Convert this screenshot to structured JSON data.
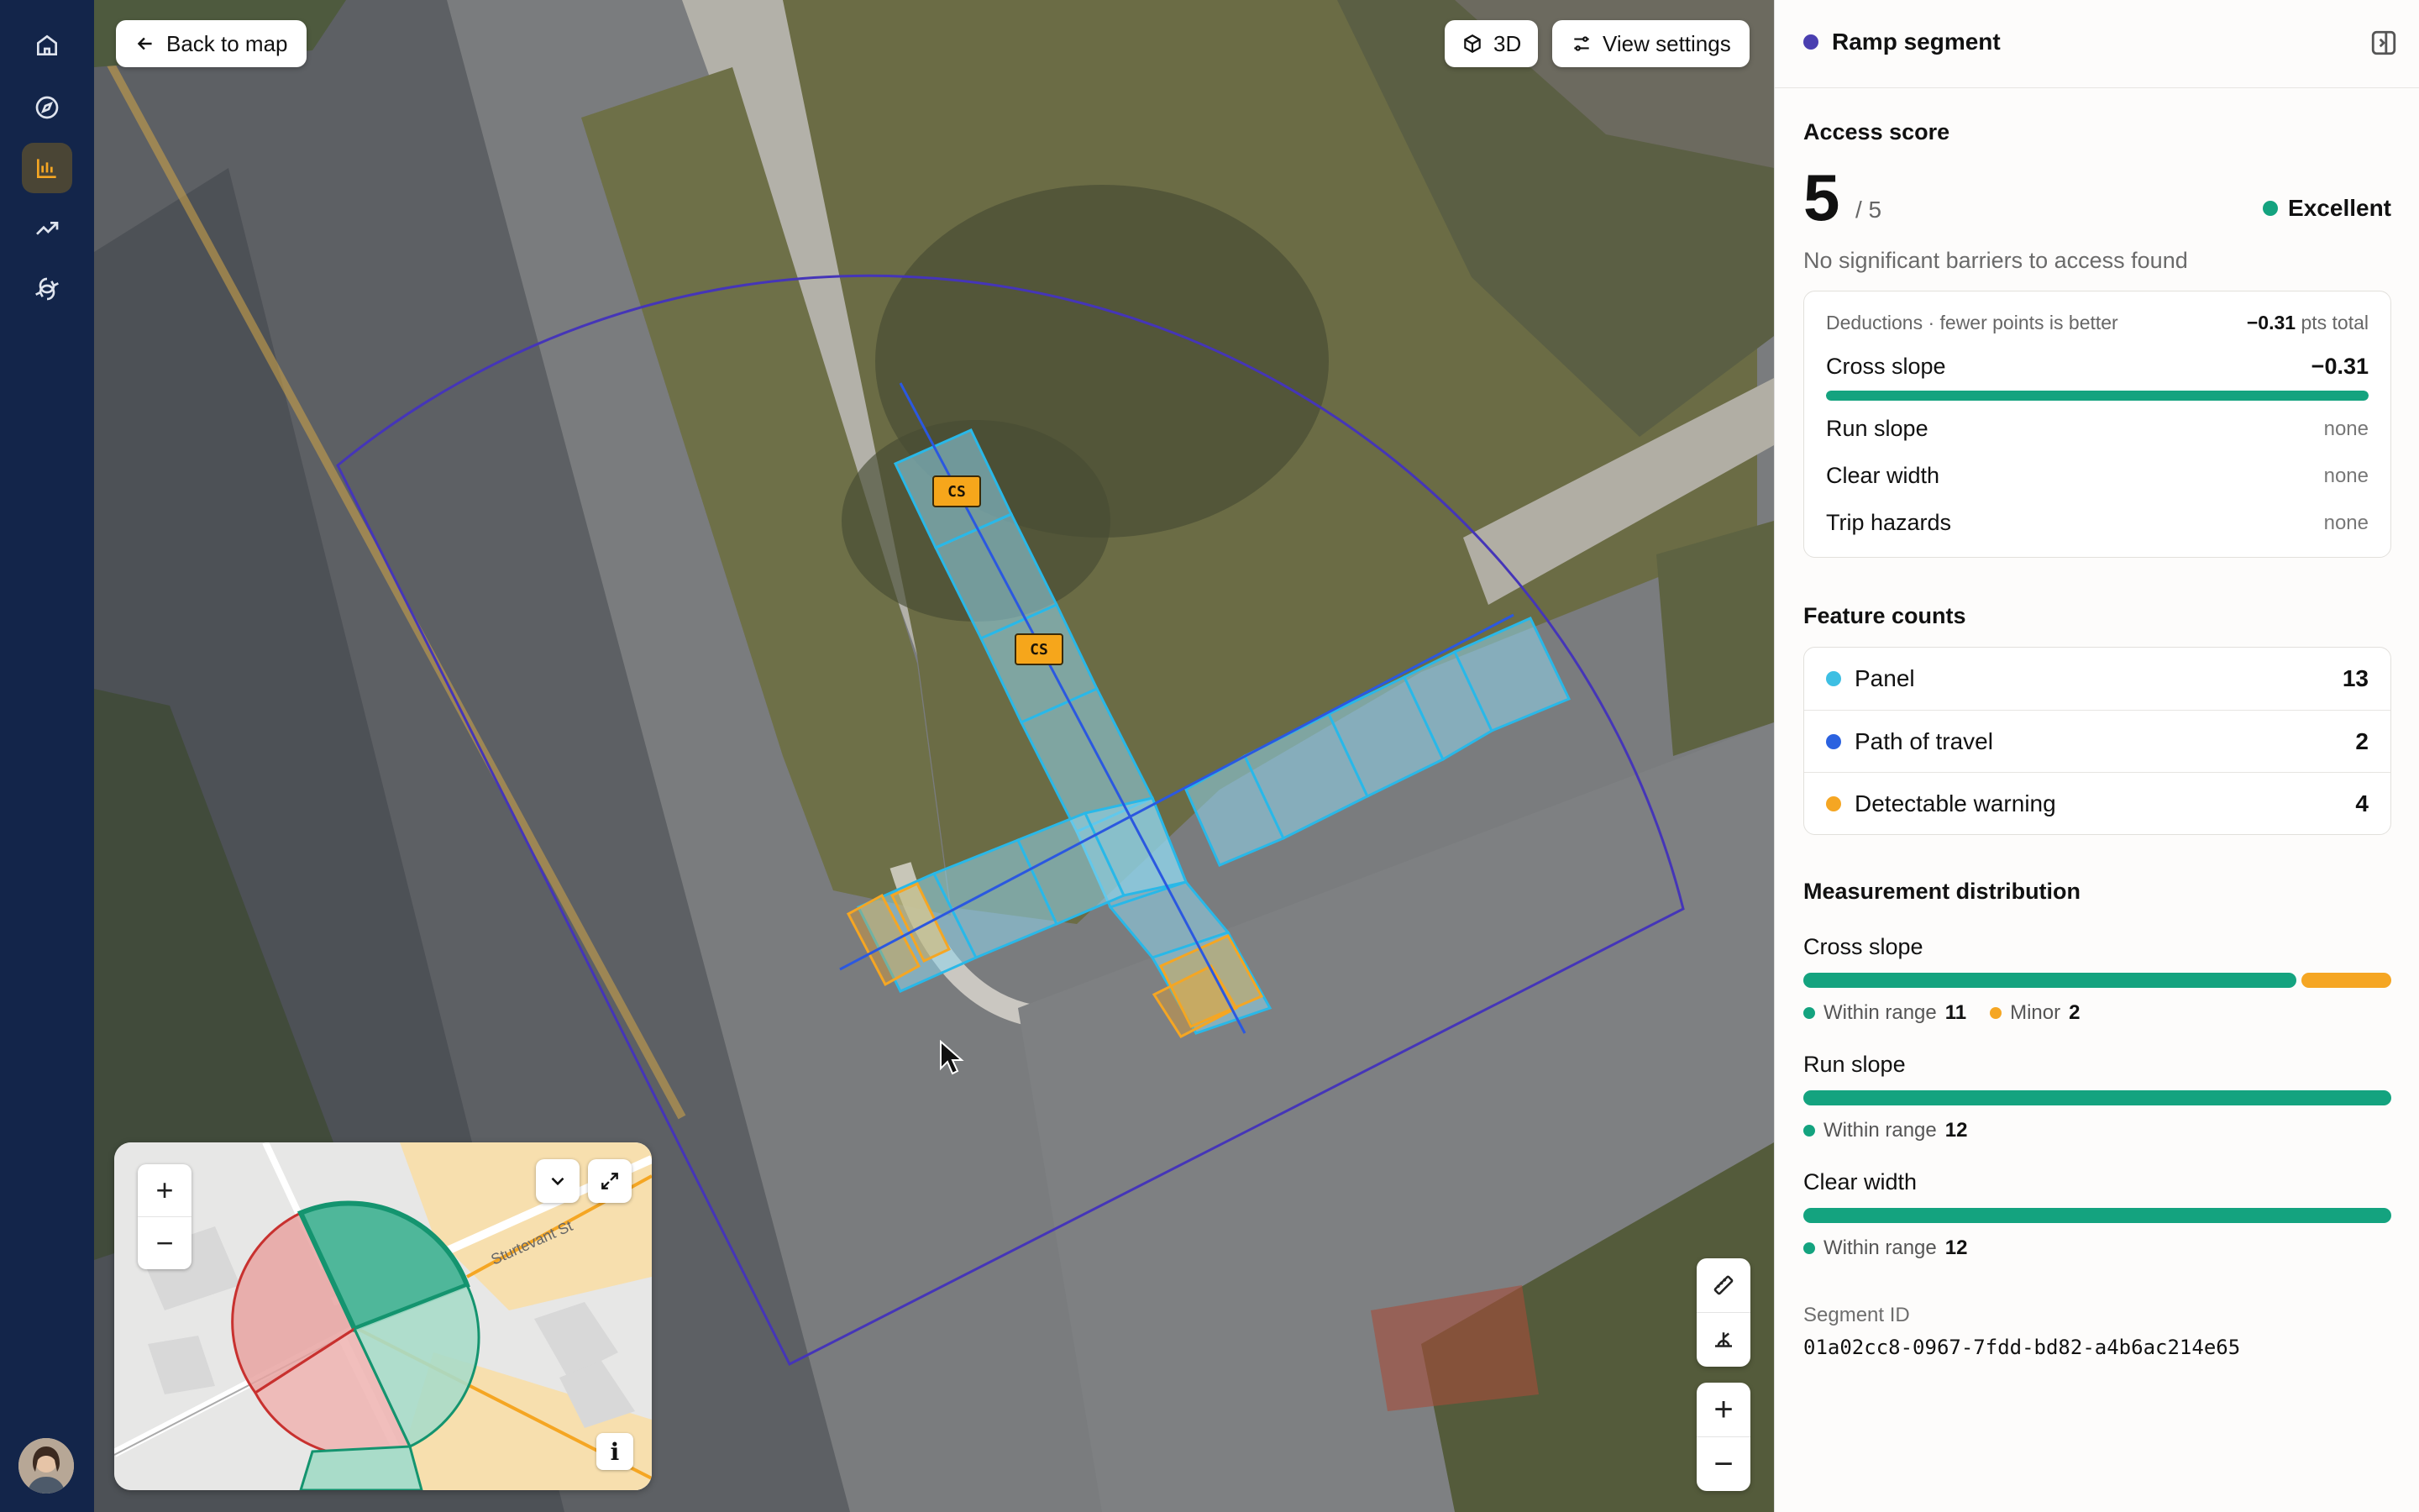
{
  "nav": {
    "items": [
      {
        "icon": "home-icon"
      },
      {
        "icon": "compass-icon"
      },
      {
        "icon": "bar-chart-icon",
        "active": true
      },
      {
        "icon": "trending-up-icon"
      },
      {
        "icon": "route-icon"
      }
    ],
    "avatar_icon": "user-avatar"
  },
  "map": {
    "back_label": "Back to map",
    "view3d_label": "3D",
    "view_settings_label": "View settings",
    "tags": [
      "CS",
      "CS"
    ],
    "minimap": {
      "street_label": "Sturtevant St",
      "zoom_in": "+",
      "zoom_out": "−",
      "info": "i"
    },
    "zoom_in": "+",
    "zoom_out": "−"
  },
  "panel": {
    "title": "Ramp segment",
    "title_dot_color": "#4a3fb0",
    "access": {
      "heading": "Access score",
      "score": "5",
      "max": "/ 5",
      "rating": "Excellent",
      "rating_color": "#14a37f",
      "description": "No significant barriers to access found"
    },
    "deductions": {
      "header": "Deductions · fewer points is better",
      "total_value": "−0.31",
      "total_unit": "pts total",
      "rows": [
        {
          "label": "Cross slope",
          "value": "−0.31",
          "bar_fraction": 1.0
        },
        {
          "label": "Run slope",
          "value": "none"
        },
        {
          "label": "Clear width",
          "value": "none"
        },
        {
          "label": "Trip hazards",
          "value": "none"
        }
      ]
    },
    "feature_counts": {
      "heading": "Feature counts",
      "rows": [
        {
          "label": "Panel",
          "count": "13",
          "color": "#3dbfe3"
        },
        {
          "label": "Path of travel",
          "count": "2",
          "color": "#2b62e0"
        },
        {
          "label": "Detectable warning",
          "count": "4",
          "color": "#f5a623"
        }
      ]
    },
    "distribution": {
      "heading": "Measurement distribution",
      "groups": [
        {
          "label": "Cross slope",
          "within_label": "Within range",
          "within": 11,
          "minor_label": "Minor",
          "minor": 2
        },
        {
          "label": "Run slope",
          "within_label": "Within range",
          "within": 12
        },
        {
          "label": "Clear width",
          "within_label": "Within range",
          "within": 12
        }
      ],
      "within_color": "#14a37f",
      "minor_color": "#f5a623"
    },
    "segment": {
      "label": "Segment ID",
      "id": "01a02cc8-0967-7fdd-bd82-a4b6ac214e65"
    }
  }
}
